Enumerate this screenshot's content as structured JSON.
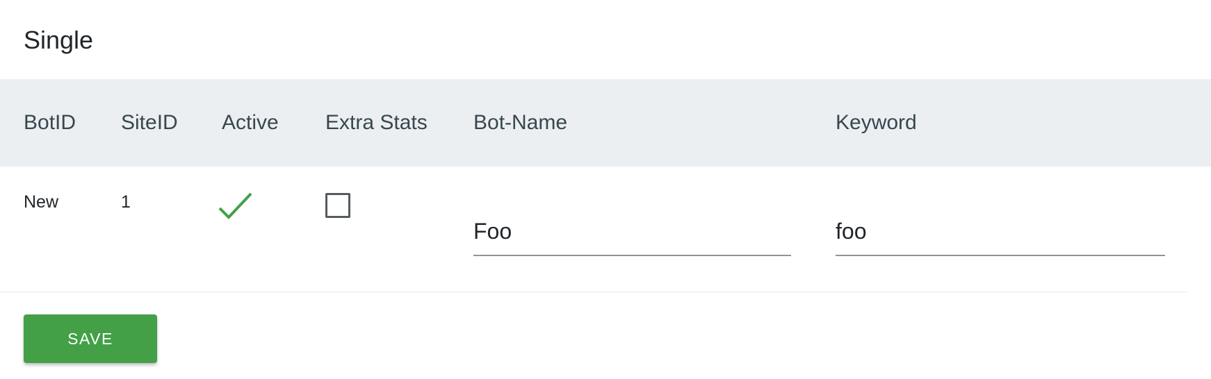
{
  "page": {
    "title": "Single"
  },
  "table": {
    "columns": [
      "BotID",
      "SiteID",
      "Active",
      "Extra Stats",
      "Bot-Name",
      "Keyword"
    ],
    "rows": [
      {
        "bot_id": "New",
        "site_id": "1",
        "active": true,
        "active_icon": "check-icon",
        "extra_stats": false,
        "bot_name": "Foo",
        "keyword": "foo"
      }
    ]
  },
  "actions": {
    "save_label": "Save"
  },
  "colors": {
    "header_bg": "#eceff1",
    "header_text": "#37474f",
    "check_color": "#43a047",
    "save_button_bg": "#43a047"
  }
}
